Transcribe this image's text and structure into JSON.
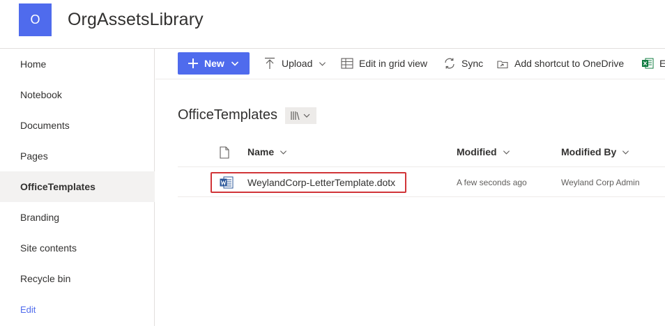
{
  "site": {
    "logo_letter": "O",
    "title": "OrgAssetsLibrary"
  },
  "leftnav": {
    "items": [
      {
        "label": "Home"
      },
      {
        "label": "Notebook"
      },
      {
        "label": "Documents"
      },
      {
        "label": "Pages"
      },
      {
        "label": "OfficeTemplates",
        "selected": true
      },
      {
        "label": "Branding"
      },
      {
        "label": "Site contents"
      },
      {
        "label": "Recycle bin"
      }
    ],
    "edit_label": "Edit"
  },
  "commandbar": {
    "new_label": "New",
    "upload_label": "Upload",
    "grid_label": "Edit in grid view",
    "sync_label": "Sync",
    "shortcut_label": "Add shortcut to OneDrive",
    "export_label": "E"
  },
  "library": {
    "title": "OfficeTemplates"
  },
  "table": {
    "headers": {
      "name": "Name",
      "modified": "Modified",
      "modified_by": "Modified By"
    },
    "rows": [
      {
        "name": "WeylandCorp-LetterTemplate.dotx",
        "modified": "A few seconds ago",
        "modified_by": "Weyland Corp Admin",
        "icon": "word-icon"
      }
    ]
  },
  "colors": {
    "accent": "#4f6bed",
    "highlight_border": "#d13438",
    "nav_selected_bg": "#f3f2f1"
  }
}
